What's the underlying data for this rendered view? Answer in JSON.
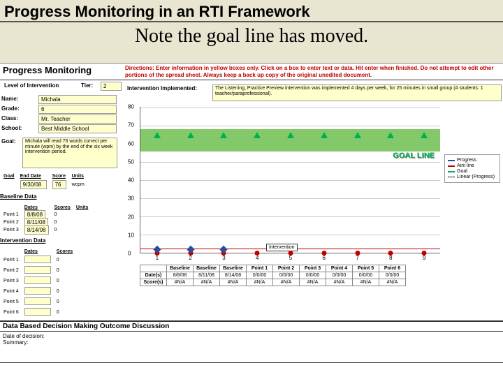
{
  "slide": {
    "title": "Progress Monitoring in an RTI Framework",
    "subtitle": "Note the goal line has moved."
  },
  "sheet": {
    "pm_title": "Progress Monitoring",
    "directions": "Directions: Enter information in yellow boxes only. Click on a box to enter text or data. Hit enter when finished. Do not attempt to edit other portions of the spread sheet. Always keep a back up copy of the original unedited document.",
    "level_label": "Level of Intervention",
    "tier_label": "Tier:",
    "tier_value": "2",
    "fields": {
      "name_label": "Name:",
      "name": "Michala",
      "grade_label": "Grade:",
      "grade": "6",
      "class_label": "Class:",
      "class": "Mr. Teacher",
      "school_label": "School:",
      "school": "Best Middle School"
    },
    "goal_label": "Goal:",
    "goal_text": "Michala will read 76 words correct per minute (wpm) by the end of the six week intervention period.",
    "interv_impl_label": "Intervention Implemented:",
    "interv_impl_text": "The Listening, Practice Preview intervention was implemented 4 days per week, for 25 minutes in small group (4 students: 1 teacher/paraprofessional).",
    "goal_row": {
      "label": "Goal",
      "end_date_h": "End Date",
      "score_h": "Score",
      "units_h": "Units",
      "end_date": "9/30/08",
      "score": "76",
      "units": "wcpm"
    },
    "baseline": {
      "label": "Baseline Data",
      "dates_h": "Dates",
      "scores_h": "Scores",
      "units_h": "Units",
      "rows": [
        {
          "p": "Point 1",
          "d": "8/8/08",
          "s": "0"
        },
        {
          "p": "Point 2",
          "d": "8/11/08",
          "s": "0"
        },
        {
          "p": "Point 3",
          "d": "8/14/08",
          "s": "0"
        }
      ]
    },
    "interv_data": {
      "label": "Intervention Data",
      "dates_h": "Dates",
      "scores_h": "Scores",
      "rows": [
        {
          "p": "Point 1",
          "s": "0"
        },
        {
          "p": "Point 2",
          "s": "0"
        },
        {
          "p": "Point 3",
          "s": "0"
        },
        {
          "p": "Point 4",
          "s": "0"
        },
        {
          "p": "Point 5",
          "s": "0"
        },
        {
          "p": "Point 6",
          "s": "0"
        }
      ]
    },
    "interv_box": "Intervention",
    "legend": {
      "progress": "Progress",
      "aim": "Aim line",
      "goal": "Goal",
      "linear": "Linear (Progress)"
    },
    "goal_line_text": "GOAL LINE",
    "decision": {
      "header": "Data Based Decision Making Outcome Discussion",
      "date_label": "Date of decision:",
      "summary_label": "Summary:"
    },
    "bottom_table": {
      "headers": [
        "Baseline",
        "Baseline",
        "Baseline",
        "Point 1",
        "Point 2",
        "Point 3",
        "Point 4",
        "Point 5",
        "Point 6"
      ],
      "row_date_label": "Date(s)",
      "dates": [
        "8/8/08",
        "8/11/08",
        "8/14/08",
        "0/0/00",
        "0/0/00",
        "0/0/00",
        "0/0/00",
        "0/0/00",
        "0/0/00"
      ],
      "row_score_label": "Score(s)",
      "scores": [
        "#N/A",
        "#N/A",
        "#N/A",
        "#N/A",
        "#N/A",
        "#N/A",
        "#N/A",
        "#N/A",
        "#N/A"
      ]
    }
  },
  "chart_data": {
    "type": "line",
    "x": [
      1,
      2,
      3,
      4,
      5,
      6,
      7,
      8,
      9
    ],
    "ylim": [
      0,
      80
    ],
    "yticks": [
      0,
      10,
      20,
      30,
      40,
      50,
      60,
      70,
      80
    ],
    "series": [
      {
        "name": "Progress",
        "values": [
          0,
          0,
          0,
          null,
          null,
          null,
          null,
          null,
          null
        ]
      },
      {
        "name": "Aim line",
        "values": [
          0,
          0,
          0,
          0,
          0,
          0,
          0,
          0,
          0
        ]
      },
      {
        "name": "Goal",
        "values": [
          66,
          66,
          66,
          66,
          66,
          66,
          66,
          66,
          66
        ]
      }
    ],
    "goal_band": [
      60,
      72
    ],
    "title": "",
    "xlabel": "",
    "ylabel": ""
  }
}
